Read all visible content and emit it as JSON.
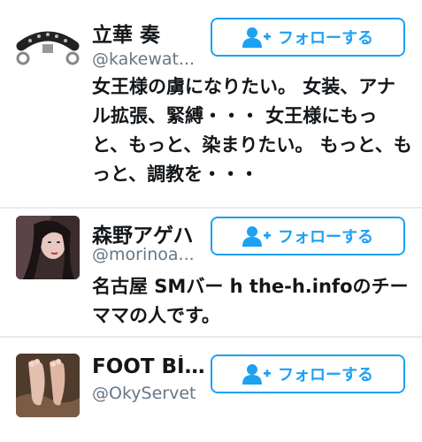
{
  "follow_label": "フォローする",
  "accent": "#1da1f2",
  "users": [
    {
      "name": "立華 奏",
      "handle": "@kakewat...",
      "bio": "女王様の虜になりたい。 女装、アナル拡張、緊縛・・・ 女王様にもっと、もっと、染まりたい。 もっと、もっと、調教を・・・"
    },
    {
      "name": "森野アゲハ",
      "handle": "@morinoa...",
      "bio": "名古屋 SMバー h the-h.infoのチーママの人です。"
    },
    {
      "name": "FOOT Bİ...",
      "handle": "@OkyServet",
      "bio": ""
    }
  ]
}
